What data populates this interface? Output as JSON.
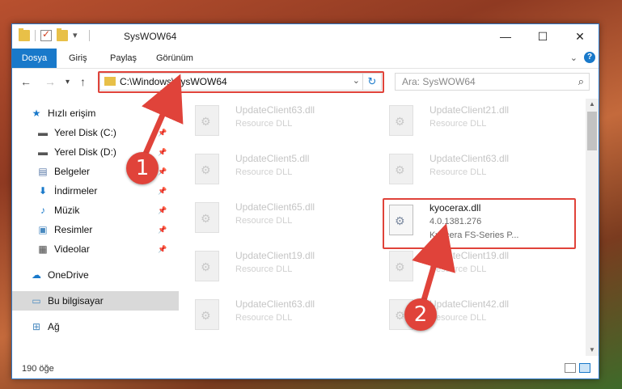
{
  "window": {
    "title": "SysWOW64",
    "caption": {
      "minimize": "—",
      "maximize": "☐",
      "close": "✕"
    }
  },
  "ribbon": {
    "tabs": [
      "Dosya",
      "Giriş",
      "Paylaş",
      "Görünüm"
    ],
    "file_color": "#1979ca"
  },
  "nav": {
    "back": "←",
    "forward": "→",
    "recent": "▾",
    "up": "↑",
    "address": "C:\\Windows\\SysWOW64",
    "search_placeholder": "Ara: SysWOW64"
  },
  "sidebar": {
    "items": [
      {
        "label": "Hızlı erişim",
        "icon": "star-icon",
        "pinned": false
      },
      {
        "label": "Yerel Disk (C:)",
        "icon": "drive-icon",
        "pinned": true
      },
      {
        "label": "Yerel Disk (D:)",
        "icon": "drive-icon",
        "pinned": true
      },
      {
        "label": "Belgeler",
        "icon": "documents-icon",
        "pinned": true
      },
      {
        "label": "İndirmeler",
        "icon": "download-icon",
        "pinned": true
      },
      {
        "label": "Müzik",
        "icon": "music-icon",
        "pinned": true
      },
      {
        "label": "Resimler",
        "icon": "pictures-icon",
        "pinned": true
      },
      {
        "label": "Videolar",
        "icon": "video-icon",
        "pinned": true
      },
      {
        "label": "OneDrive",
        "icon": "cloud-icon",
        "pinned": false
      },
      {
        "label": "Bu bilgisayar",
        "icon": "computer-icon",
        "pinned": false,
        "selected": true
      },
      {
        "label": "Ağ",
        "icon": "network-icon",
        "pinned": false
      }
    ]
  },
  "files": [
    {
      "name": "UpdateClient63.dll",
      "sub": "Resource DLL",
      "desc": ""
    },
    {
      "name": "UpdateClient21.dll",
      "sub": "Resource DLL",
      "desc": ""
    },
    {
      "name": "UpdateClient5.dll",
      "sub": "Resource DLL",
      "desc": ""
    },
    {
      "name": "UpdateClient63.dll",
      "sub": "Resource DLL",
      "desc": ""
    },
    {
      "name": "UpdateClient65.dll",
      "sub": "Resource DLL",
      "desc": ""
    },
    {
      "name": "kyocerax.dll",
      "sub": "4.0.1381.276",
      "desc": "Kyocera FS-Series P...",
      "active": true
    },
    {
      "name": "UpdateClient19.dll",
      "sub": "Resource DLL",
      "desc": ""
    },
    {
      "name": "UpdateClient19.dll",
      "sub": "Resource DLL",
      "desc": ""
    },
    {
      "name": "UpdateClient63.dll",
      "sub": "Resource DLL",
      "desc": ""
    },
    {
      "name": "UpdateClient42.dll",
      "sub": "Resource DLL",
      "desc": ""
    }
  ],
  "status": {
    "count": "190 öğe"
  },
  "annotations": {
    "step1": "1",
    "step2": "2",
    "color": "#e0433a"
  }
}
